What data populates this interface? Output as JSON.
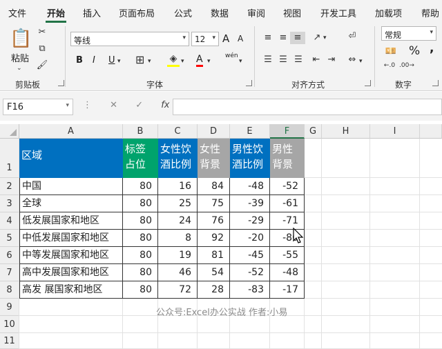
{
  "tabs": [
    "文件",
    "开始",
    "插入",
    "页面布局",
    "公式",
    "数据",
    "审阅",
    "视图",
    "开发工具",
    "加载项",
    "帮助"
  ],
  "ribbon": {
    "clipboard": {
      "paste_label": "粘贴",
      "group_label": "剪贴板"
    },
    "font": {
      "font_name": "等线",
      "font_size": "12",
      "bold": "B",
      "italic": "I",
      "underline": "U",
      "group_label": "字体",
      "grow": "A",
      "shrink": "A",
      "font_color": "A",
      "phonetic": "wén"
    },
    "alignment": {
      "group_label": "对齐方式"
    },
    "number": {
      "format": "常规",
      "percent": "%",
      "comma": ",",
      "group_label": "数字"
    }
  },
  "formula_bar": {
    "name_box": "F16",
    "fx": "fx",
    "value": ""
  },
  "columns": [
    "A",
    "B",
    "C",
    "D",
    "E",
    "F",
    "G",
    "H",
    "I"
  ],
  "rows": [
    "1",
    "2",
    "3",
    "4",
    "5",
    "6",
    "7",
    "8",
    "9",
    "10",
    "11"
  ],
  "table": {
    "headers": [
      "区域",
      "标签占位",
      "女性饮酒比例",
      "女性背景",
      "男性饮酒比例",
      "男性背景"
    ],
    "header_lines": [
      [
        "区域"
      ],
      [
        "标签",
        "占位"
      ],
      [
        "女性饮",
        "酒比例"
      ],
      [
        "女性",
        "背景"
      ],
      [
        "男性饮",
        "酒比例"
      ],
      [
        "男性",
        "背景"
      ]
    ],
    "header_colors": [
      "#0070c0",
      "#00a36c",
      "#0070c0",
      "#a6a6a6",
      "#0070c0",
      "#a6a6a6"
    ],
    "rows": [
      [
        "中国",
        "80",
        "16",
        "84",
        "-48",
        "-52"
      ],
      [
        "全球",
        "80",
        "25",
        "75",
        "-39",
        "-61"
      ],
      [
        "低发展国家和地区",
        "80",
        "24",
        "76",
        "-29",
        "-71"
      ],
      [
        "中低发展国家和地区",
        "80",
        "8",
        "92",
        "-20",
        "-80"
      ],
      [
        "中等发展国家和地区",
        "80",
        "19",
        "81",
        "-45",
        "-55"
      ],
      [
        "高中发展国家和地区",
        "80",
        "46",
        "54",
        "-52",
        "-48"
      ],
      [
        "高发 展国家和地区",
        "80",
        "72",
        "28",
        "-83",
        "-17"
      ]
    ]
  },
  "watermark": "公众号:Excel办公实战  作者:小易"
}
